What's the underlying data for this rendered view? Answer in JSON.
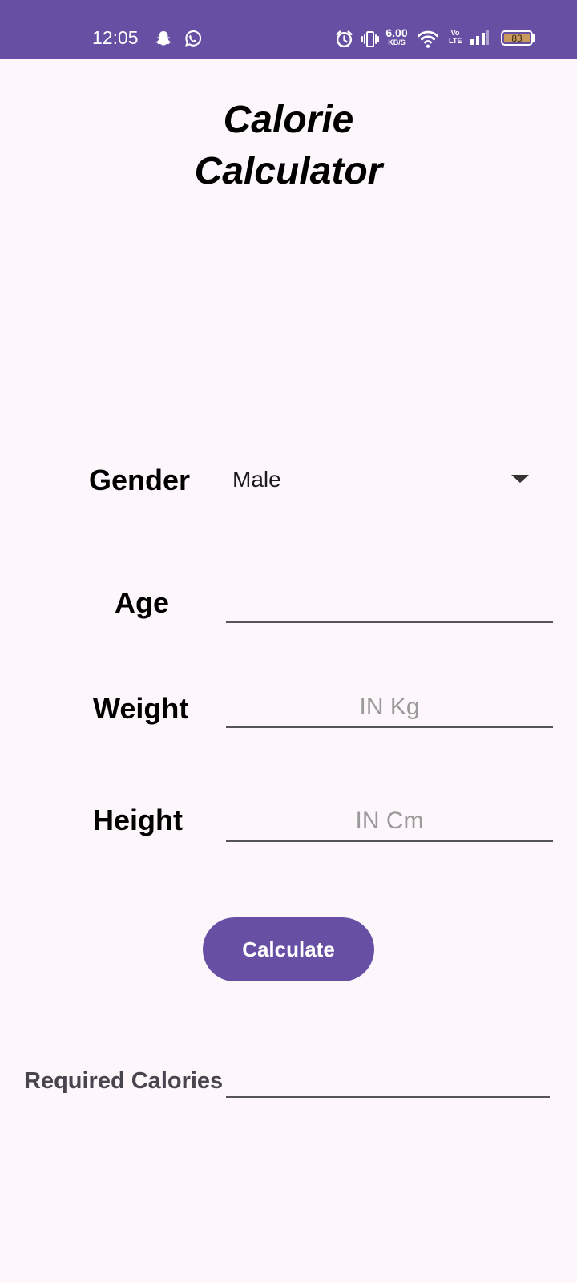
{
  "status_bar": {
    "time": "12:05",
    "net_speed_value": "6.00",
    "net_speed_unit": "KB/S",
    "volte_top": "Vo",
    "volte_bottom": "LTE",
    "battery_level": "83",
    "color": "#6750A4"
  },
  "title": {
    "line1": "Calorie",
    "line2": "Calculator"
  },
  "form": {
    "gender_label": "Gender",
    "gender_value": "Male",
    "age_label": "Age",
    "age_value": "",
    "weight_label": "Weight",
    "weight_placeholder": "IN Kg",
    "weight_value": "",
    "height_label": "Height",
    "height_placeholder": "IN Cm",
    "height_value": ""
  },
  "calculate_button": {
    "label": "Calculate",
    "color": "#6750A4"
  },
  "result": {
    "label": "Required Calories",
    "value": ""
  },
  "icons": [
    "snapchat-icon",
    "whatsapp-icon",
    "alarm-icon",
    "vibrate-icon",
    "wifi-icon",
    "signal-icon",
    "battery-icon",
    "dropdown-arrow-icon"
  ]
}
